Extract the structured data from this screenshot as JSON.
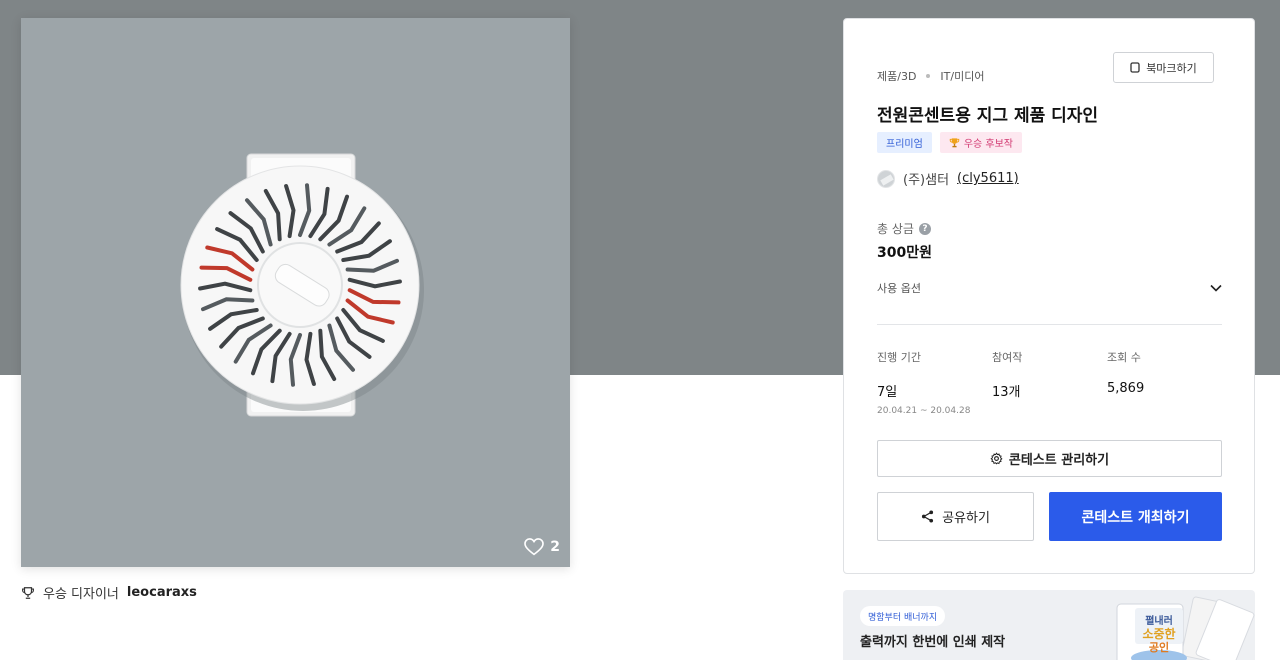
{
  "hero": {
    "likes_count": "2"
  },
  "winner": {
    "prefix": "우승 디자이너",
    "name": "leocaraxs"
  },
  "card": {
    "category_1": "제품/3D",
    "category_2": "IT/미디어",
    "bookmark_label": "북마크하기",
    "title": "전원콘센트용 지그 제품 디자인",
    "badge_premium": "프리미엄",
    "badge_candidate": "우승 후보작",
    "host_name": "(주)샘터",
    "host_id": "(cly5611)",
    "prize_label": "총 상금",
    "prize_value": "300만원",
    "options_label": "사용 옵션",
    "stats": [
      {
        "label": "진행 기간",
        "value": "7일",
        "sub": "20.04.21 ~ 20.04.28"
      },
      {
        "label": "참여작",
        "value": "13개",
        "sub": ""
      },
      {
        "label": "조회 수",
        "value": "5,869",
        "sub": ""
      }
    ],
    "manage_label": "콘테스트 관리하기",
    "share_label": "공유하기",
    "open_label": "콘테스트 개최하기"
  },
  "ad": {
    "pill": "명함부터 배너까지",
    "headline": "출력까지 한번에 인쇄 제작",
    "art_text": "펼내러 소중한 공인"
  },
  "colors": {
    "band": "#7f8587",
    "accent": "#2b5bea",
    "dial_red": "#c0392b"
  },
  "icons": {
    "like": "heart-outline-icon",
    "winner": "trophy-icon",
    "bookmark": "bookmark-icon",
    "help": "question-circle-icon",
    "options": "chevron-down-icon",
    "manage": "gear-icon",
    "share": "share-icon"
  }
}
